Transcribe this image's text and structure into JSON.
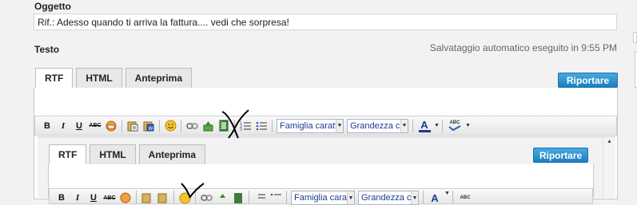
{
  "subject": {
    "label": "Oggetto",
    "value": "Rif.: Adesso quando ti arriva la fattura.... vedi che sorpresa!"
  },
  "body": {
    "label": "Testo",
    "autosave_status": "Salvataggio automatico eseguito in 9:55 PM"
  },
  "editor": {
    "tabs": [
      {
        "label": "RTF",
        "active": true
      },
      {
        "label": "HTML",
        "active": false
      },
      {
        "label": "Anteprima",
        "active": false
      }
    ],
    "reply_button": "Riportare",
    "toolbar": {
      "bold": "B",
      "italic": "I",
      "underline": "U",
      "strike": "ABC",
      "font_family": "Famiglia caratt",
      "font_size": "Grandezza car",
      "font_color": "A",
      "spellcheck": "ABC"
    }
  },
  "nested_editor": {
    "tabs": [
      {
        "label": "RTF",
        "active": true
      },
      {
        "label": "HTML",
        "active": false
      },
      {
        "label": "Anteprima",
        "active": false
      }
    ],
    "reply_button": "Riportare",
    "toolbar": {
      "bold": "B",
      "italic": "I",
      "underline": "U",
      "strike": "ABC",
      "font_family": "Famiglia caratt",
      "font_size": "Grandezza car",
      "font_color": "A",
      "spellcheck": "ABC"
    }
  },
  "colors": {
    "accent": "#1a7fc0",
    "annotation": "#000000"
  },
  "icons": [
    "eraser-icon",
    "paste-text-icon",
    "paste-word-icon",
    "smiley-icon",
    "link-icon",
    "image-icon",
    "video-icon",
    "numbered-list-icon",
    "bullet-list-icon",
    "font-color-icon",
    "spellcheck-icon"
  ]
}
